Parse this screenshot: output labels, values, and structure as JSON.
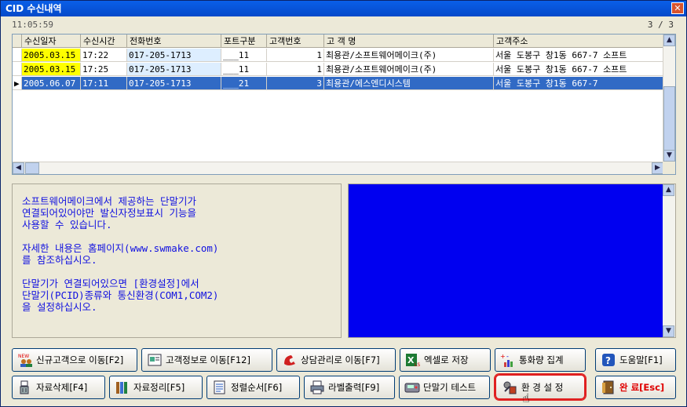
{
  "window": {
    "title": "CID 수신내역",
    "close": "✕"
  },
  "status": {
    "time": "11:05:59",
    "count": "3 / 3"
  },
  "grid": {
    "headers": [
      "수신일자",
      "수신시간",
      "전화번호",
      "포트구분",
      "고객번호",
      "고 객 명",
      "고객주소"
    ],
    "rows": [
      {
        "date": "2005.03.15",
        "time": "17:22",
        "phone": "017-205-1713",
        "port": "___11",
        "cust_no": "1",
        "name": "최용관/소프트웨어메이크(주)",
        "address": "서울 도봉구 창1동 667-7 소프트"
      },
      {
        "date": "2005.03.15",
        "time": "17:25",
        "phone": "017-205-1713",
        "port": "___11",
        "cust_no": "1",
        "name": "최용관/소프트웨어메이크(주)",
        "address": "서울 도봉구 창1동 667-7 소프트"
      },
      {
        "date": "2005.06.07",
        "time": "17:11",
        "phone": "017-205-1713",
        "port": "___21",
        "cust_no": "3",
        "name": "최용관/에스엔디시스템",
        "address": "서울 도봉구 창1동 667-7"
      }
    ]
  },
  "message": {
    "p1": "소프트웨어메이크에서 제공하는 단말기가\n연결되어있어야만 발신자정보표시 기능을\n사용할 수 있습니다.",
    "p2": "자세한 내용은 홈페이지(www.swmake.com)\n를 참조하십시오.",
    "p3": "단말기가 연결되어있으면 [환경설정]에서\n단말기(PCID)종류와 통신환경(COM1,COM2)\n을 설정하십시오."
  },
  "buttons": {
    "new_customer": "신규고객으로 이동[F2]",
    "customer_info": "고객정보로 이동[F12]",
    "consult": "상담관리로 이동[F7]",
    "excel": "엑셀로 저장",
    "call_stats": "통화량 집계",
    "help": "도움말[F1]",
    "delete": "자료삭제[F4]",
    "cleanup": "자료정리[F5]",
    "sort": "정렬순서[F6]",
    "label": "라벨출력[F9]",
    "terminal_test": "단말기 테스트",
    "settings": "환 경 설 정",
    "exit": "완 료[Esc]"
  },
  "icons": {
    "new_badge": "NEW"
  }
}
